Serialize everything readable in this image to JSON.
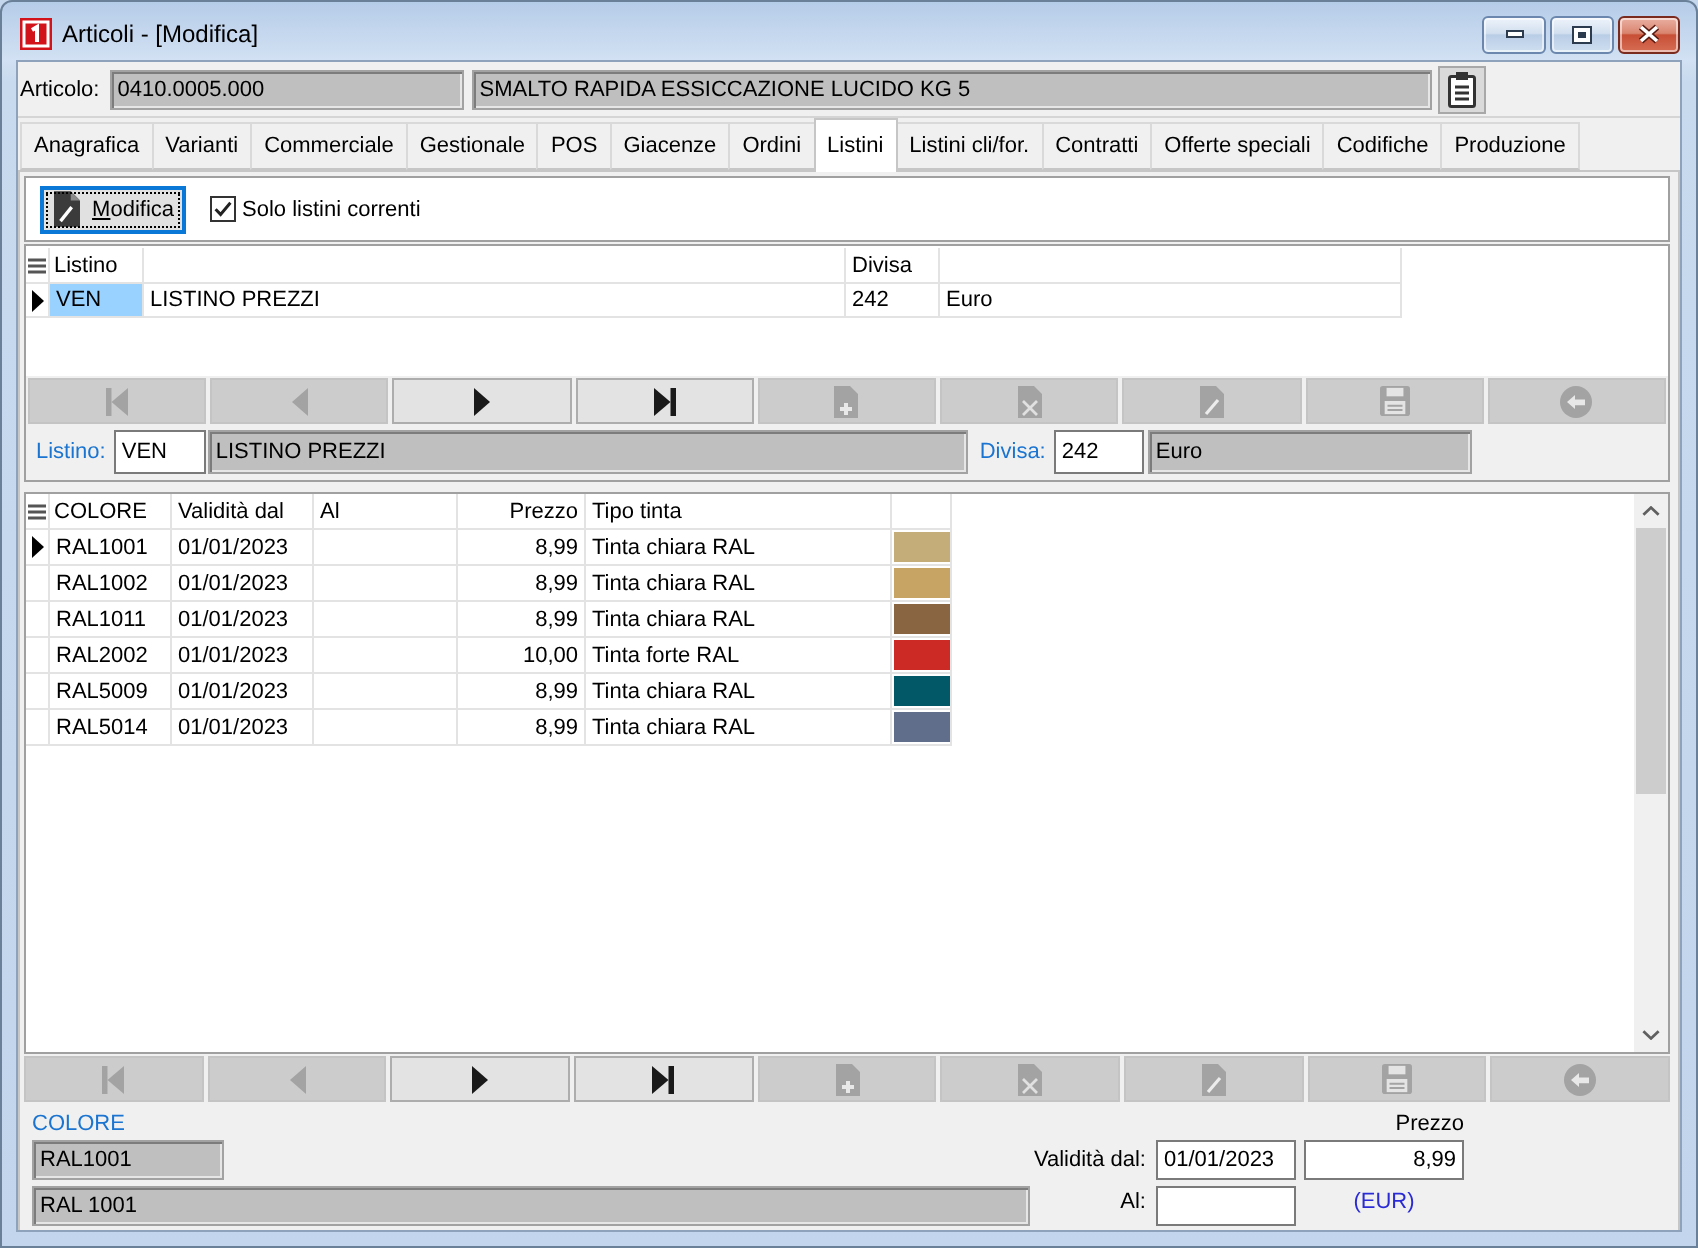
{
  "window": {
    "title": "Articoli - [Modifica]"
  },
  "article": {
    "label": "Articolo:",
    "code": "0410.0005.000",
    "description": "SMALTO RAPIDA ESSICCAZIONE LUCIDO KG 5"
  },
  "tabs": [
    {
      "label": "Anagrafica",
      "selected": false
    },
    {
      "label": "Varianti",
      "selected": false
    },
    {
      "label": "Commerciale",
      "selected": false
    },
    {
      "label": "Gestionale",
      "selected": false
    },
    {
      "label": "POS",
      "selected": false
    },
    {
      "label": "Giacenze",
      "selected": false
    },
    {
      "label": "Ordini",
      "selected": false
    },
    {
      "label": "Listini",
      "selected": true
    },
    {
      "label": "Listini cli/for.",
      "selected": false
    },
    {
      "label": "Contratti",
      "selected": false
    },
    {
      "label": "Offerte speciali",
      "selected": false
    },
    {
      "label": "Codifiche",
      "selected": false
    },
    {
      "label": "Produzione",
      "selected": false
    }
  ],
  "toolbar": {
    "edit_button": "Modifica",
    "current_only": {
      "label": "Solo listini correnti",
      "checked": true
    }
  },
  "price_lists": {
    "header": {
      "code": "Listino",
      "currency": "Divisa"
    },
    "rows": [
      {
        "code": "VEN",
        "name": "LISTINO PREZZI",
        "currency_code": "242",
        "currency_name": "Euro",
        "selected": true
      }
    ],
    "nav_buttons": [
      {
        "kind": "first",
        "disabled": true
      },
      {
        "kind": "previous",
        "disabled": true
      },
      {
        "kind": "next",
        "disabled": false
      },
      {
        "kind": "last",
        "disabled": false
      },
      {
        "kind": "new",
        "disabled": true
      },
      {
        "kind": "delete",
        "disabled": true
      },
      {
        "kind": "edit",
        "disabled": true
      },
      {
        "kind": "save",
        "disabled": true
      },
      {
        "kind": "undo",
        "disabled": true
      }
    ],
    "detail": {
      "list_label": "Listino:",
      "list_code": "VEN",
      "list_name": "LISTINO PREZZI",
      "currency_label": "Divisa:",
      "currency_code": "242",
      "currency_name": "Euro"
    }
  },
  "colors": {
    "header": {
      "code": "COLORE",
      "valid_from": "Validità dal",
      "valid_to": "Al",
      "price": "Prezzo",
      "tint_type": "Tipo tinta"
    },
    "rows": [
      {
        "code": "RAL1001",
        "valid_from": "01/01/2023",
        "price": "8,99",
        "tint_type": "Tinta chiara RAL",
        "color": "#c4ad78",
        "selected": true
      },
      {
        "code": "RAL1002",
        "valid_from": "01/01/2023",
        "price": "8,99",
        "tint_type": "Tinta chiara RAL",
        "color": "#c8a464",
        "selected": false
      },
      {
        "code": "RAL1011",
        "valid_from": "01/01/2023",
        "price": "8,99",
        "tint_type": "Tinta chiara RAL",
        "color": "#8a6542",
        "selected": false
      },
      {
        "code": "RAL2002",
        "valid_from": "01/01/2023",
        "price": "10,00",
        "tint_type": "Tinta forte RAL",
        "color": "#cc2a24",
        "selected": false
      },
      {
        "code": "RAL5009",
        "valid_from": "01/01/2023",
        "price": "8,99",
        "tint_type": "Tinta chiara RAL",
        "color": "#035868",
        "selected": false
      },
      {
        "code": "RAL5014",
        "valid_from": "01/01/2023",
        "price": "8,99",
        "tint_type": "Tinta chiara RAL",
        "color": "#606e8c",
        "selected": false
      }
    ],
    "nav_buttons": [
      {
        "kind": "first",
        "disabled": true
      },
      {
        "kind": "previous",
        "disabled": true
      },
      {
        "kind": "next",
        "disabled": false
      },
      {
        "kind": "last",
        "disabled": false
      },
      {
        "kind": "new",
        "disabled": true
      },
      {
        "kind": "delete",
        "disabled": true
      },
      {
        "kind": "edit",
        "disabled": true
      },
      {
        "kind": "save",
        "disabled": true
      },
      {
        "kind": "undo",
        "disabled": true
      }
    ]
  },
  "color_detail": {
    "section_label": "COLORE",
    "code": "RAL1001",
    "description": "RAL 1001",
    "valid_from_label": "Validità dal:",
    "valid_from": "01/01/2023",
    "valid_to_label": "Al:",
    "price_label": "Prezzo",
    "price": "8,99",
    "currency_note": "(EUR)"
  }
}
